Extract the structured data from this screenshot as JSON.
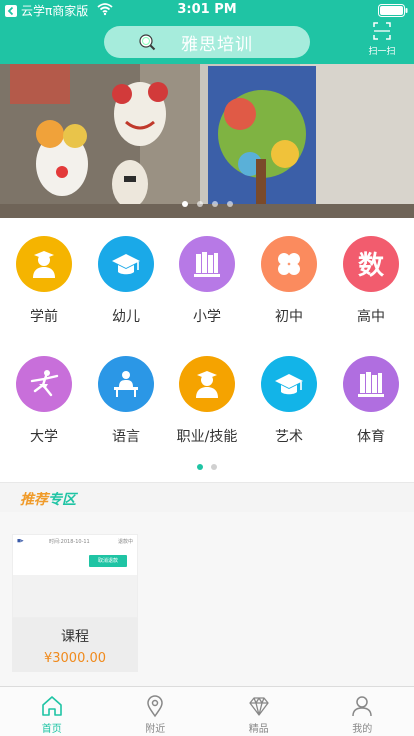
{
  "status": {
    "app_back": "云学π商家版",
    "time": "3:01 PM"
  },
  "header": {
    "search_text": "雅思培训",
    "scan_label": "扫一扫"
  },
  "banner": {
    "dot_count": 4,
    "active_index": 0
  },
  "categories": [
    {
      "label": "学前",
      "icon": "graduate-icon",
      "color": "#f5b400"
    },
    {
      "label": "幼儿",
      "icon": "mortarboard-icon",
      "color": "#1aa9e8"
    },
    {
      "label": "小学",
      "icon": "books-icon",
      "color": "#b779e6"
    },
    {
      "label": "初中",
      "icon": "clover-icon",
      "color": "#fb8b5e"
    },
    {
      "label": "高中",
      "icon": "math-character-icon",
      "color": "#f25c6e"
    },
    {
      "label": "大学",
      "icon": "dancer-icon",
      "color": "#c86fda"
    },
    {
      "label": "语言",
      "icon": "teacher-desk-icon",
      "color": "#2b97e6"
    },
    {
      "label": "职业/技能",
      "icon": "graduate-icon",
      "color": "#f5a300"
    },
    {
      "label": "艺术",
      "icon": "mortarboard-icon",
      "color": "#12b4e8"
    },
    {
      "label": "体育",
      "icon": "books-icon",
      "color": "#b06ee0"
    }
  ],
  "section": {
    "title_part1": "推荐",
    "title_part2": "专区"
  },
  "card": {
    "thumb_meta": "时间:2018-10-11",
    "thumb_status": "退款中",
    "thumb_button": "取消退款",
    "title": "课程",
    "price": "¥3000.00"
  },
  "tabs": [
    {
      "label": "首页",
      "icon": "home-icon",
      "active": true
    },
    {
      "label": "附近",
      "icon": "location-pin-icon",
      "active": false
    },
    {
      "label": "精品",
      "icon": "diamond-icon",
      "active": false
    },
    {
      "label": "我的",
      "icon": "person-icon",
      "active": false
    }
  ],
  "colors": {
    "primary": "#1fc4a4",
    "price": "#f08a1c",
    "section_accent": "#f09b2a"
  }
}
